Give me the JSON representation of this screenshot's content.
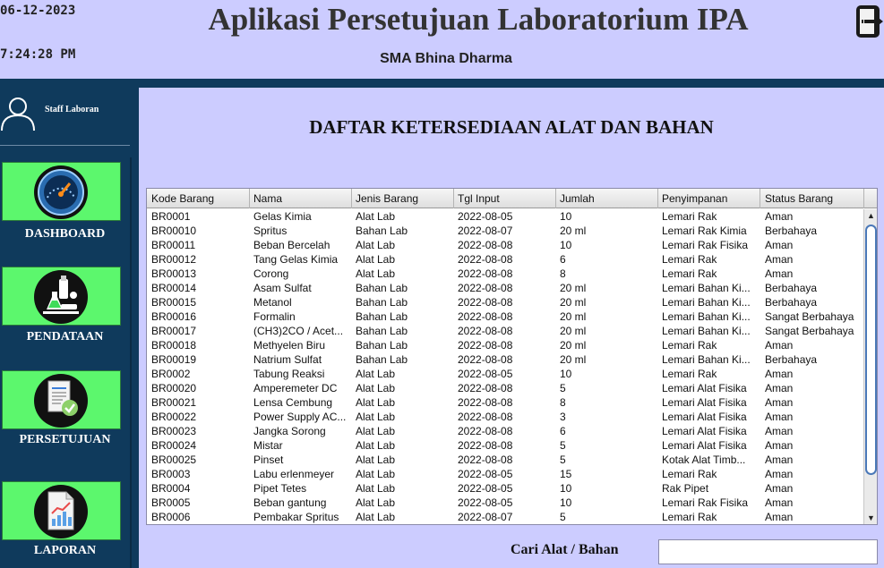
{
  "header": {
    "date": "06-12-2023",
    "time": "7:24:28 PM",
    "title": "Aplikasi Persetujuan Laboratorium IPA",
    "school": "SMA Bhina Dharma"
  },
  "sidebar": {
    "user_label": "Staff Laboran",
    "menu": [
      {
        "label": "DASHBOARD",
        "icon": "gauge-icon"
      },
      {
        "label": "PENDATAAN",
        "icon": "lab-equipment-icon"
      },
      {
        "label": "PERSETUJUAN",
        "icon": "approved-document-icon"
      },
      {
        "label": "LAPORAN",
        "icon": "report-chart-icon"
      }
    ]
  },
  "main": {
    "title": "DAFTAR KETERSEDIAAN ALAT DAN BAHAN",
    "search_label": "Cari Alat / Bahan",
    "search_value": ""
  },
  "table": {
    "columns": [
      "Kode Barang",
      "Nama",
      "Jenis Barang",
      "Tgl Input",
      "Jumlah",
      "Penyimpanan",
      "Status Barang"
    ],
    "rows": [
      [
        "BR0001",
        "Gelas Kimia",
        "Alat Lab",
        "2022-08-05",
        "10",
        "Lemari Rak",
        "Aman"
      ],
      [
        "BR00010",
        "Spritus",
        "Bahan Lab",
        "2022-08-07",
        "20 ml",
        "Lemari Rak Kimia",
        "Berbahaya"
      ],
      [
        "BR00011",
        "Beban Bercelah",
        "Alat Lab",
        "2022-08-08",
        "10",
        "Lemari Rak Fisika",
        "Aman"
      ],
      [
        "BR00012",
        "Tang Gelas Kimia",
        "Alat Lab",
        "2022-08-08",
        "6",
        "Lemari Rak",
        "Aman"
      ],
      [
        "BR00013",
        "Corong",
        "Alat Lab",
        "2022-08-08",
        "8",
        "Lemari Rak",
        "Aman"
      ],
      [
        "BR00014",
        "Asam Sulfat",
        "Bahan Lab",
        "2022-08-08",
        "20 ml",
        "Lemari Bahan Ki...",
        "Berbahaya"
      ],
      [
        "BR00015",
        "Metanol",
        "Bahan Lab",
        "2022-08-08",
        "20 ml",
        "Lemari Bahan Ki...",
        "Berbahaya"
      ],
      [
        "BR00016",
        "Formalin",
        "Bahan Lab",
        "2022-08-08",
        "20 ml",
        "Lemari Bahan Ki...",
        "Sangat Berbahaya"
      ],
      [
        "BR00017",
        "(CH3)2CO / Acet...",
        "Bahan Lab",
        "2022-08-08",
        "20 ml",
        "Lemari Bahan Ki...",
        "Sangat Berbahaya"
      ],
      [
        "BR00018",
        "Methyelen Biru",
        "Bahan Lab",
        "2022-08-08",
        "20 ml",
        "Lemari Rak",
        "Aman"
      ],
      [
        "BR00019",
        "Natrium Sulfat",
        "Bahan Lab",
        "2022-08-08",
        "20 ml",
        "Lemari Bahan Ki...",
        "Berbahaya"
      ],
      [
        "BR0002",
        "Tabung Reaksi",
        "Alat Lab",
        "2022-08-05",
        "10",
        "Lemari Rak",
        "Aman"
      ],
      [
        "BR00020",
        "Amperemeter DC",
        "Alat Lab",
        "2022-08-08",
        "5",
        "Lemari Alat Fisika",
        "Aman"
      ],
      [
        "BR00021",
        "Lensa Cembung",
        "Alat Lab",
        "2022-08-08",
        "8",
        "Lemari Alat Fisika",
        "Aman"
      ],
      [
        "BR00022",
        "Power Supply AC...",
        "Alat Lab",
        "2022-08-08",
        "3",
        "Lemari Alat Fisika",
        "Aman"
      ],
      [
        "BR00023",
        "Jangka Sorong",
        "Alat Lab",
        "2022-08-08",
        "6",
        "Lemari Alat Fisika",
        "Aman"
      ],
      [
        "BR00024",
        "Mistar",
        "Alat Lab",
        "2022-08-08",
        "5",
        "Lemari Alat Fisika",
        "Aman"
      ],
      [
        "BR00025",
        "Pinset",
        "Alat Lab",
        "2022-08-08",
        "5",
        "Kotak Alat Timb...",
        "Aman"
      ],
      [
        "BR0003",
        "Labu erlenmeyer",
        "Alat Lab",
        "2022-08-05",
        "15",
        "Lemari Rak",
        "Aman"
      ],
      [
        "BR0004",
        "Pipet Tetes",
        "Alat Lab",
        "2022-08-05",
        "10",
        "Rak Pipet",
        "Aman"
      ],
      [
        "BR0005",
        "Beban gantung",
        "Alat Lab",
        "2022-08-05",
        "10",
        "Lemari Rak Fisika",
        "Aman"
      ],
      [
        "BR0006",
        "Pembakar Spritus",
        "Alat Lab",
        "2022-08-07",
        "5",
        "Lemari Rak",
        "Aman"
      ]
    ]
  },
  "colors": {
    "background": "#ccccff",
    "sidebar": "#0f3a5c",
    "menu_button": "#5cf76d"
  },
  "icons": {
    "logout": "logout-icon",
    "user": "user-icon"
  }
}
